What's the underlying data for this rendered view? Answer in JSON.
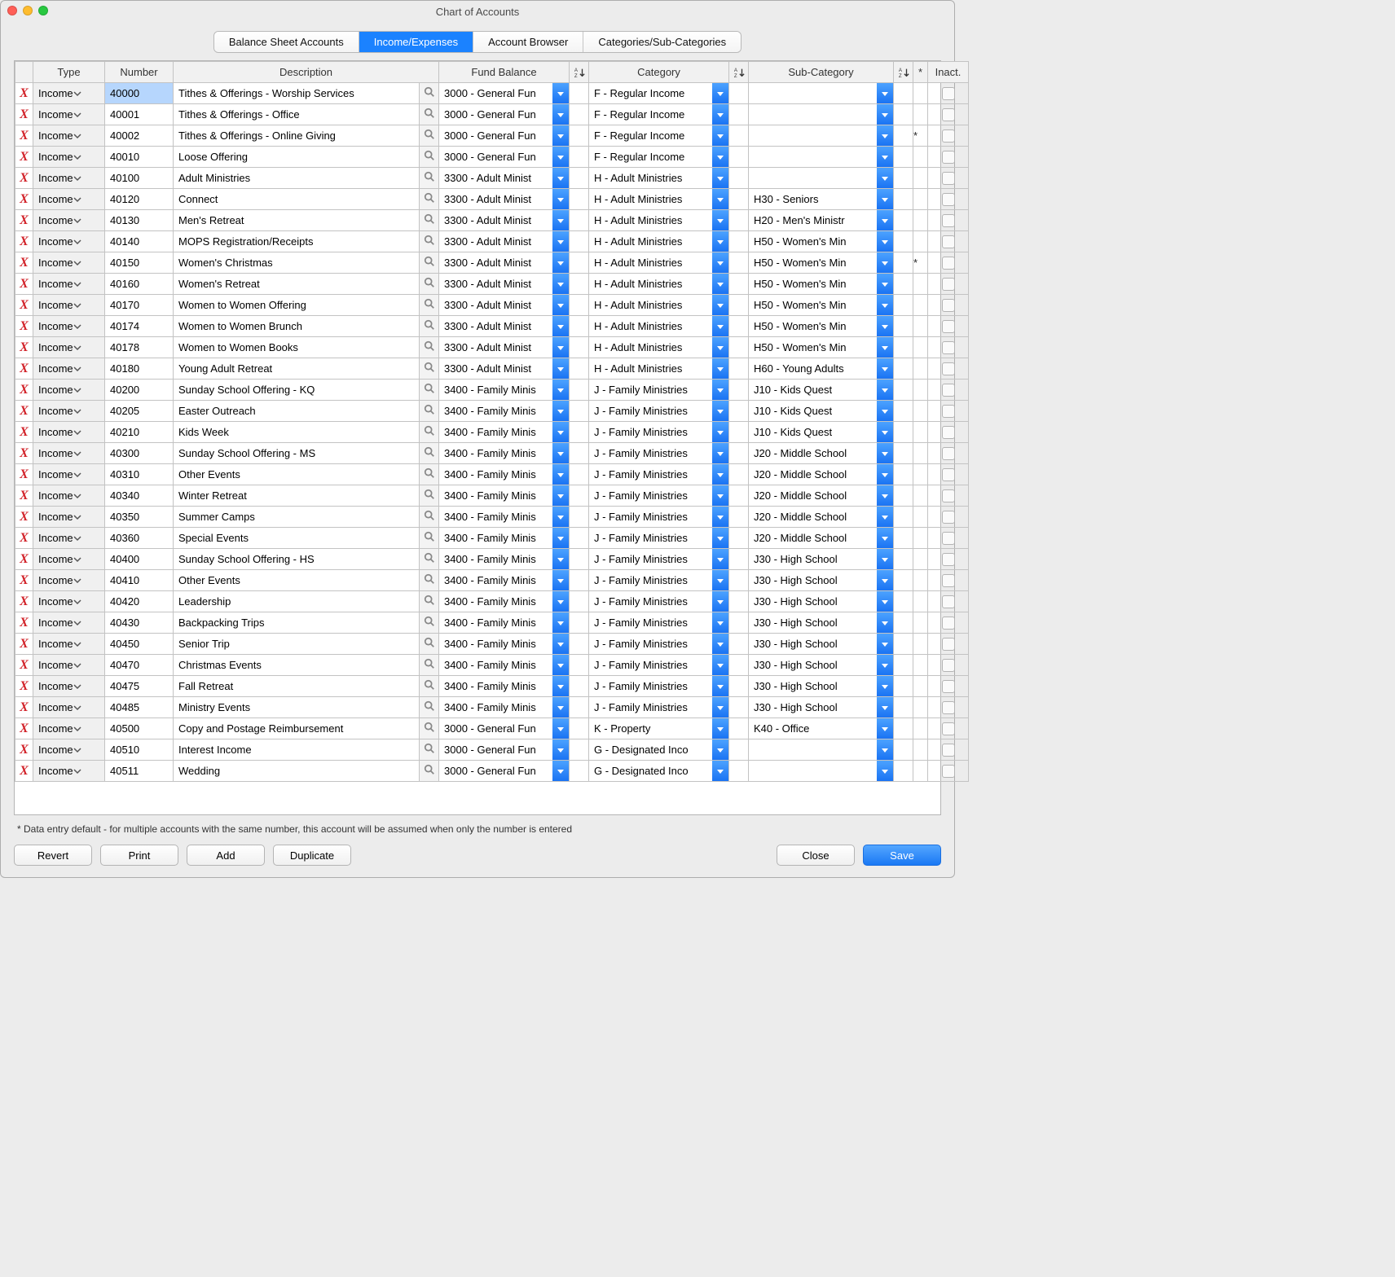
{
  "window": {
    "title": "Chart of Accounts"
  },
  "tabs": [
    {
      "label": "Balance Sheet Accounts",
      "active": false
    },
    {
      "label": "Income/Expenses",
      "active": true
    },
    {
      "label": "Account Browser",
      "active": false
    },
    {
      "label": "Categories/Sub-Categories",
      "active": false
    }
  ],
  "headers": {
    "type": "Type",
    "number": "Number",
    "description": "Description",
    "fund": "Fund Balance",
    "category": "Category",
    "subcat": "Sub-Category",
    "star": "*",
    "inact": "Inact."
  },
  "rows": [
    {
      "type": "Income",
      "num": "40000",
      "desc": "Tithes & Offerings - Worship Services",
      "fund": "3000 - General Fun",
      "cat": "F - Regular Income",
      "sub": "",
      "star": "",
      "sel": true
    },
    {
      "type": "Income",
      "num": "40001",
      "desc": "Tithes & Offerings - Office",
      "fund": "3000 - General Fun",
      "cat": "F - Regular Income",
      "sub": "",
      "star": ""
    },
    {
      "type": "Income",
      "num": "40002",
      "desc": "Tithes & Offerings - Online Giving",
      "fund": "3000 - General Fun",
      "cat": "F - Regular Income",
      "sub": "",
      "star": "*"
    },
    {
      "type": "Income",
      "num": "40010",
      "desc": "Loose Offering",
      "fund": "3000 - General Fun",
      "cat": "F - Regular Income",
      "sub": "",
      "star": ""
    },
    {
      "type": "Income",
      "num": "40100",
      "desc": "Adult Ministries",
      "fund": "3300 - Adult Minist",
      "cat": "H - Adult Ministries",
      "sub": "",
      "star": ""
    },
    {
      "type": "Income",
      "num": "40120",
      "desc": "Connect",
      "fund": "3300 - Adult Minist",
      "cat": "H - Adult Ministries",
      "sub": "H30 - Seniors",
      "star": ""
    },
    {
      "type": "Income",
      "num": "40130",
      "desc": "Men's Retreat",
      "fund": "3300 - Adult Minist",
      "cat": "H - Adult Ministries",
      "sub": "H20 - Men's Ministr",
      "star": ""
    },
    {
      "type": "Income",
      "num": "40140",
      "desc": "MOPS Registration/Receipts",
      "fund": "3300 - Adult Minist",
      "cat": "H - Adult Ministries",
      "sub": "H50 - Women's Min",
      "star": ""
    },
    {
      "type": "Income",
      "num": "40150",
      "desc": "Women's Christmas",
      "fund": "3300 - Adult Minist",
      "cat": "H - Adult Ministries",
      "sub": "H50 - Women's Min",
      "star": "*"
    },
    {
      "type": "Income",
      "num": "40160",
      "desc": "Women's Retreat",
      "fund": "3300 - Adult Minist",
      "cat": "H - Adult Ministries",
      "sub": "H50 - Women's Min",
      "star": ""
    },
    {
      "type": "Income",
      "num": "40170",
      "desc": "Women to Women Offering",
      "fund": "3300 - Adult Minist",
      "cat": "H - Adult Ministries",
      "sub": "H50 - Women's Min",
      "star": ""
    },
    {
      "type": "Income",
      "num": "40174",
      "desc": "Women to Women Brunch",
      "fund": "3300 - Adult Minist",
      "cat": "H - Adult Ministries",
      "sub": "H50 - Women's Min",
      "star": ""
    },
    {
      "type": "Income",
      "num": "40178",
      "desc": "Women to Women Books",
      "fund": "3300 - Adult Minist",
      "cat": "H - Adult Ministries",
      "sub": "H50 - Women's Min",
      "star": ""
    },
    {
      "type": "Income",
      "num": "40180",
      "desc": "Young Adult Retreat",
      "fund": "3300 - Adult Minist",
      "cat": "H - Adult Ministries",
      "sub": "H60 - Young Adults",
      "star": ""
    },
    {
      "type": "Income",
      "num": "40200",
      "desc": "Sunday School Offering - KQ",
      "fund": "3400 - Family Minis",
      "cat": "J - Family Ministries",
      "sub": "J10 - Kids Quest",
      "star": ""
    },
    {
      "type": "Income",
      "num": "40205",
      "desc": "Easter Outreach",
      "fund": "3400 - Family Minis",
      "cat": "J - Family Ministries",
      "sub": "J10 - Kids Quest",
      "star": ""
    },
    {
      "type": "Income",
      "num": "40210",
      "desc": "Kids Week",
      "fund": "3400 - Family Minis",
      "cat": "J - Family Ministries",
      "sub": "J10 - Kids Quest",
      "star": ""
    },
    {
      "type": "Income",
      "num": "40300",
      "desc": "Sunday School Offering - MS",
      "fund": "3400 - Family Minis",
      "cat": "J - Family Ministries",
      "sub": "J20 - Middle School",
      "star": ""
    },
    {
      "type": "Income",
      "num": "40310",
      "desc": "Other Events",
      "fund": "3400 - Family Minis",
      "cat": "J - Family Ministries",
      "sub": "J20 - Middle School",
      "star": ""
    },
    {
      "type": "Income",
      "num": "40340",
      "desc": "Winter Retreat",
      "fund": "3400 - Family Minis",
      "cat": "J - Family Ministries",
      "sub": "J20 - Middle School",
      "star": ""
    },
    {
      "type": "Income",
      "num": "40350",
      "desc": "Summer Camps",
      "fund": "3400 - Family Minis",
      "cat": "J - Family Ministries",
      "sub": "J20 - Middle School",
      "star": ""
    },
    {
      "type": "Income",
      "num": "40360",
      "desc": "Special Events",
      "fund": "3400 - Family Minis",
      "cat": "J - Family Ministries",
      "sub": "J20 - Middle School",
      "star": ""
    },
    {
      "type": "Income",
      "num": "40400",
      "desc": "Sunday School Offering - HS",
      "fund": "3400 - Family Minis",
      "cat": "J - Family Ministries",
      "sub": "J30 - High School",
      "star": ""
    },
    {
      "type": "Income",
      "num": "40410",
      "desc": "Other Events",
      "fund": "3400 - Family Minis",
      "cat": "J - Family Ministries",
      "sub": "J30 - High School",
      "star": ""
    },
    {
      "type": "Income",
      "num": "40420",
      "desc": "Leadership",
      "fund": "3400 - Family Minis",
      "cat": "J - Family Ministries",
      "sub": "J30 - High School",
      "star": ""
    },
    {
      "type": "Income",
      "num": "40430",
      "desc": "Backpacking Trips",
      "fund": "3400 - Family Minis",
      "cat": "J - Family Ministries",
      "sub": "J30 - High School",
      "star": ""
    },
    {
      "type": "Income",
      "num": "40450",
      "desc": "Senior Trip",
      "fund": "3400 - Family Minis",
      "cat": "J - Family Ministries",
      "sub": "J30 - High School",
      "star": ""
    },
    {
      "type": "Income",
      "num": "40470",
      "desc": "Christmas Events",
      "fund": "3400 - Family Minis",
      "cat": "J - Family Ministries",
      "sub": "J30 - High School",
      "star": ""
    },
    {
      "type": "Income",
      "num": "40475",
      "desc": "Fall Retreat",
      "fund": "3400 - Family Minis",
      "cat": "J - Family Ministries",
      "sub": "J30 - High School",
      "star": ""
    },
    {
      "type": "Income",
      "num": "40485",
      "desc": "Ministry Events",
      "fund": "3400 - Family Minis",
      "cat": "J - Family Ministries",
      "sub": "J30 - High School",
      "star": ""
    },
    {
      "type": "Income",
      "num": "40500",
      "desc": "Copy and Postage Reimbursement",
      "fund": "3000 - General Fun",
      "cat": "K - Property",
      "sub": "K40 - Office",
      "star": ""
    },
    {
      "type": "Income",
      "num": "40510",
      "desc": "Interest Income",
      "fund": "3000 - General Fun",
      "cat": "G - Designated Inco",
      "sub": "",
      "star": ""
    },
    {
      "type": "Income",
      "num": "40511",
      "desc": "Wedding",
      "fund": "3000 - General Fun",
      "cat": "G - Designated Inco",
      "sub": "",
      "star": ""
    }
  ],
  "footnote": "* Data entry default - for multiple accounts with the same number, this account will be assumed when only the number is entered",
  "buttons": {
    "revert": "Revert",
    "print": "Print",
    "add": "Add",
    "duplicate": "Duplicate",
    "close": "Close",
    "save": "Save"
  }
}
